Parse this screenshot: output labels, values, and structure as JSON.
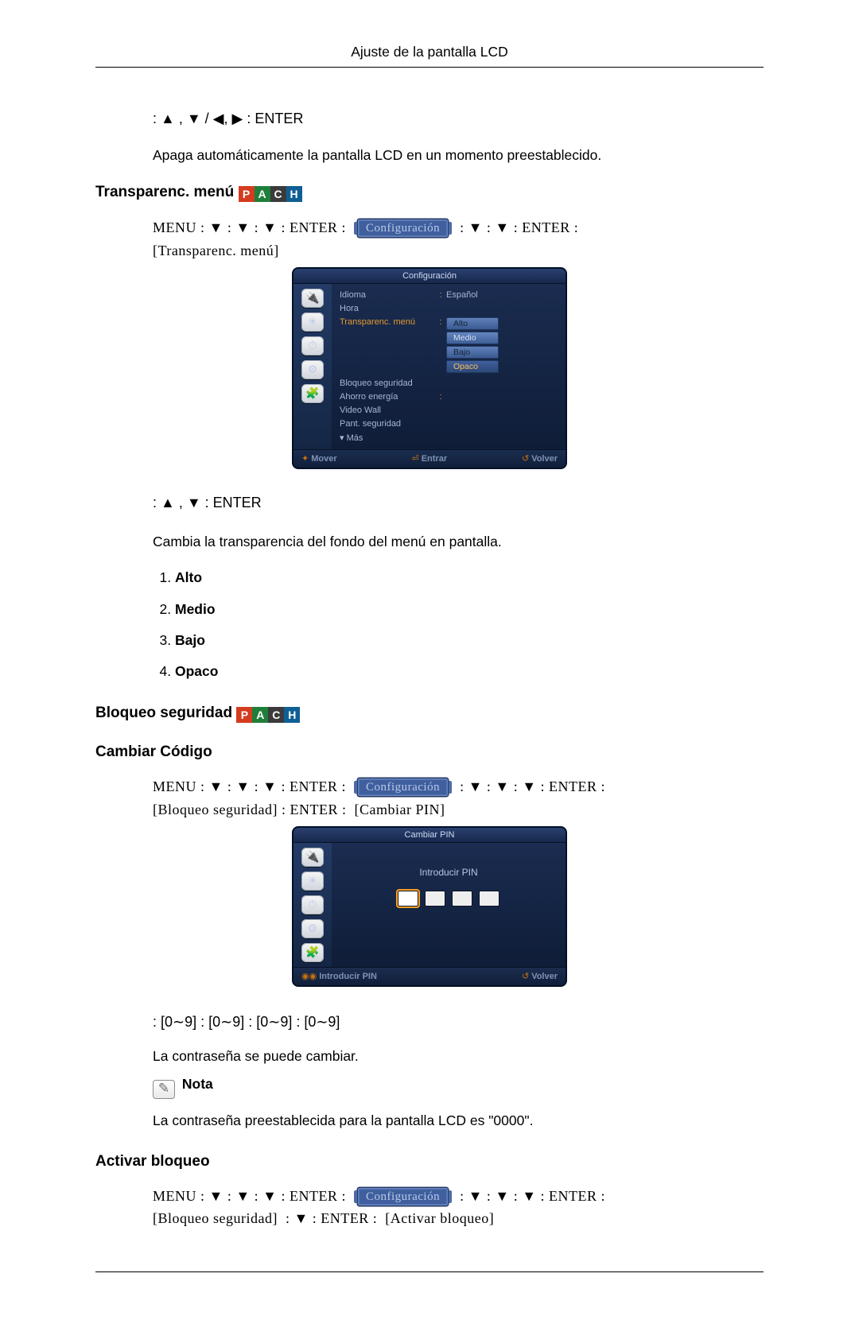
{
  "header": {
    "title": "Ajuste de la pantalla LCD"
  },
  "section_timer": {
    "nav": ": ▲ , ▼ / ◀, ▶  : ENTER",
    "desc": "Apaga automáticamente la pantalla LCD en un momento preestablecido."
  },
  "section_transp": {
    "heading": "Transparenc. menú",
    "nav1_a": "MENU   :   ▼   : ▼   : ▼   :   ENTER   :",
    "cfg_chip": "Configuración",
    "nav1_b": ":    ▼ :   ▼   :   ENTER   :",
    "nav1_c": "[Transparenc. menú]",
    "nav2": ": ▲ , ▼  : ENTER",
    "desc2": "Cambia la transparencia del fondo del menú en pantalla.",
    "options": [
      "Alto",
      "Medio",
      "Bajo",
      "Opaco"
    ]
  },
  "osd1": {
    "title": "Configuración",
    "items": [
      {
        "label": "Idioma",
        "val": "Español",
        "type": "val"
      },
      {
        "label": "Hora",
        "val": "",
        "type": "none"
      },
      {
        "label": "Transparenc. menú",
        "val": "",
        "type": "opts",
        "hl": true
      },
      {
        "label": "Bloqueo seguridad",
        "val": "",
        "type": "none"
      },
      {
        "label": "Ahorro energía",
        "val": "",
        "type": "none"
      },
      {
        "label": "Video Wall",
        "val": "",
        "type": "none"
      },
      {
        "label": "Pant. seguridad",
        "val": "",
        "type": "none"
      },
      {
        "label": "▾ Más",
        "val": "",
        "type": "none"
      }
    ],
    "opts": [
      "Alto",
      "Medio",
      "Bajo",
      "Opaco"
    ],
    "foot": {
      "move": "Mover",
      "enter": "Entrar",
      "back": "Volver"
    }
  },
  "section_lock": {
    "heading": "Bloqueo seguridad",
    "sub1": "Cambiar Código",
    "nav1_a": "MENU   :   ▼   : ▼   : ▼   :   ENTER   :",
    "nav1_b": ":   ▼ :   ▼ :   ▼   :   ENTER   :",
    "nav1_c": "[Bloqueo seguridad]",
    "nav1_d": ": ENTER :",
    "nav1_e": "[Cambiar PIN]",
    "pin_nav": ": [0∼9]  : [0∼9]  : [0∼9]  : [0∼9]",
    "desc": "La contraseña se puede cambiar.",
    "note_label": "Nota",
    "note_text": "La contraseña preestablecida para la pantalla LCD es \"0000\"."
  },
  "osd2": {
    "title": "Cambiar PIN",
    "prompt": "Introducir PIN",
    "foot": {
      "hint": "Introducir PIN",
      "back": "Volver"
    }
  },
  "section_activar": {
    "heading": "Activar bloqueo",
    "nav_a": "MENU   :   ▼   : ▼   : ▼   :   ENTER   :",
    "nav_b": ":   ▼ :   ▼ :   ▼   :   ENTER   :",
    "nav_c": "[Bloqueo seguridad]",
    "nav_d": ":  ▼  : ENTER  :",
    "nav_e": "[Activar bloqueo]"
  }
}
